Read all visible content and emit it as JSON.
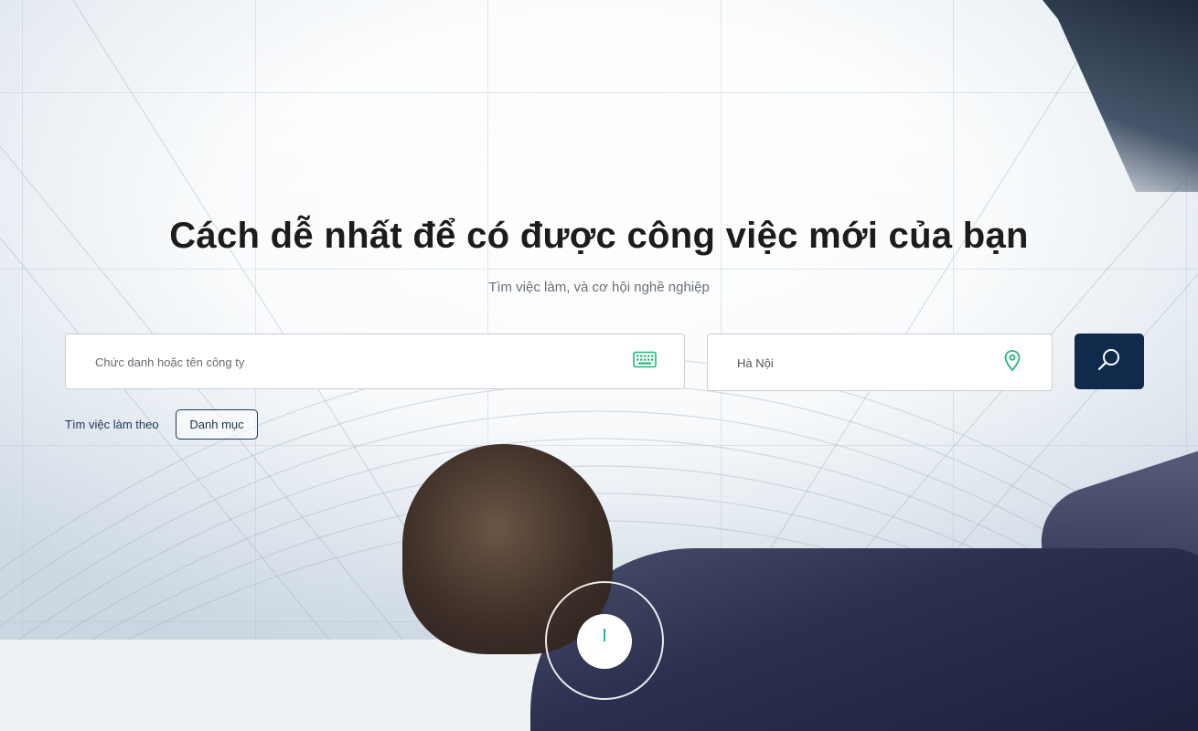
{
  "hero": {
    "title": "Cách dễ nhất để có được công việc mới của bạn",
    "subtitle": "Tìm việc làm, và cơ hội nghề nghiệp"
  },
  "search": {
    "keyword_placeholder": "Chức danh hoặc tên công ty",
    "keyword_icon": "keyboard-icon",
    "location_value": "Hà Nội",
    "location_icon": "map-pin-icon",
    "submit_icon": "search-icon"
  },
  "browse": {
    "label": "Tìm việc làm theo",
    "category_button": "Danh mục"
  },
  "colors": {
    "accent_green": "#21b97a",
    "primary_navy": "#0f2a4a",
    "title_text": "#1c1c1c"
  }
}
